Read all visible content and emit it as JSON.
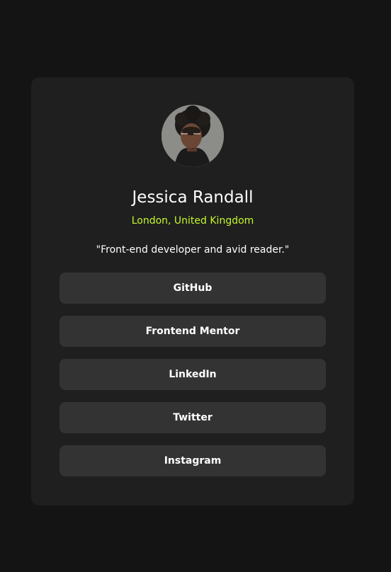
{
  "profile": {
    "avatar_alt": "Jessica Randall",
    "name": "Jessica Randall",
    "location": "London, United Kingdom",
    "bio": "\"Front-end developer and avid reader.\""
  },
  "links": [
    {
      "label": "GitHub"
    },
    {
      "label": "Frontend Mentor"
    },
    {
      "label": "LinkedIn"
    },
    {
      "label": "Twitter"
    },
    {
      "label": "Instagram"
    }
  ],
  "colors": {
    "page_background": "#141414",
    "card_background": "#1f1f1f",
    "button_background": "#333333",
    "accent": "#c4f82a",
    "text": "#ffffff"
  }
}
